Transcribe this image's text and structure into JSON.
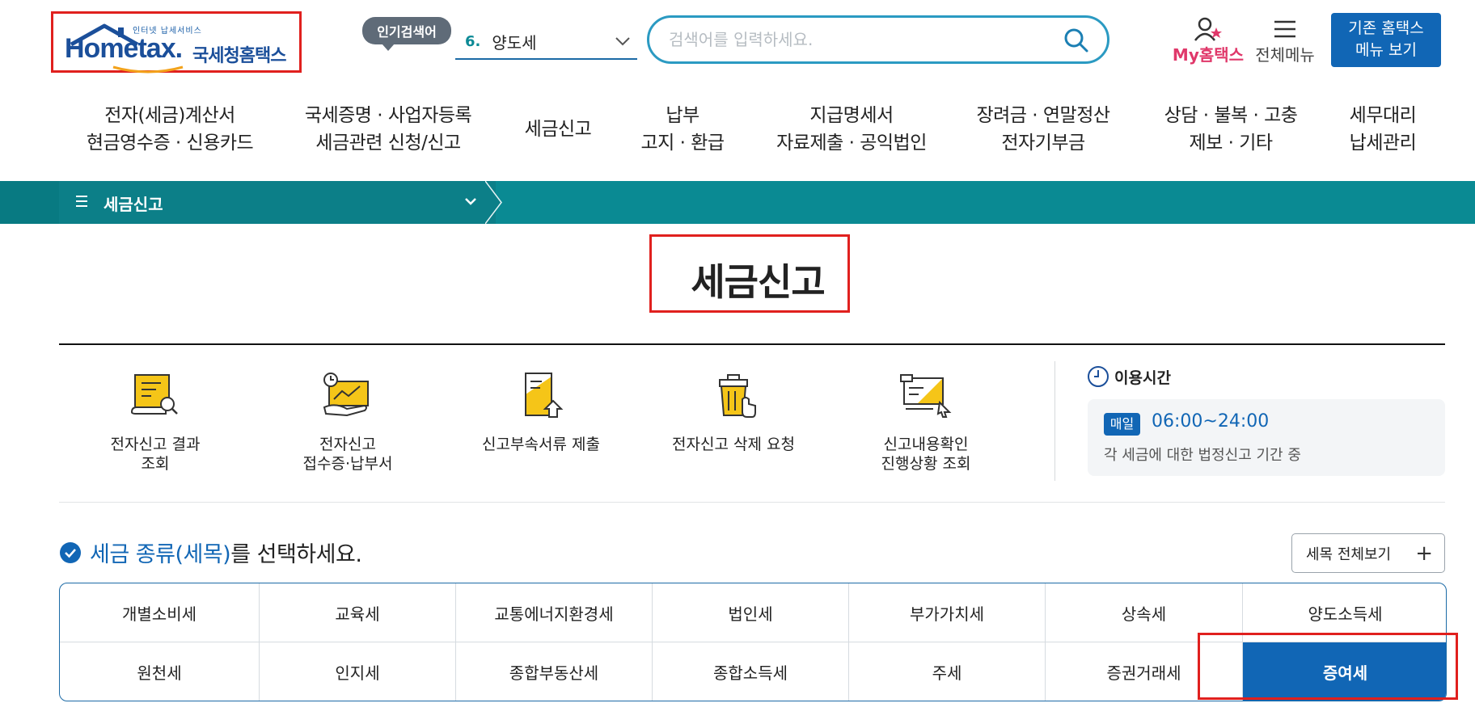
{
  "header": {
    "logo": {
      "small_text": "인터넷 납세서비스",
      "brand": "Hometax.",
      "korean_name": "국세청홈택스"
    },
    "popular": {
      "badge": "인기검색어",
      "rank": "6.",
      "keyword": "양도세"
    },
    "search": {
      "placeholder": "검색어를 입력하세요."
    },
    "my_hometax": "My홈택스",
    "all_menu": "전체메뉴",
    "legacy_button": {
      "line1": "기존 홈택스",
      "line2": "메뉴 보기"
    }
  },
  "gnb": [
    {
      "line1": "전자(세금)계산서",
      "line2": "현금영수증 · 신용카드"
    },
    {
      "line1": "국세증명 · 사업자등록",
      "line2": "세금관련 신청/신고"
    },
    {
      "line1": "세금신고",
      "line2": ""
    },
    {
      "line1": "납부",
      "line2": "고지 · 환급"
    },
    {
      "line1": "지급명세서",
      "line2": "자료제출 · 공익법인"
    },
    {
      "line1": "장려금 · 연말정산",
      "line2": "전자기부금"
    },
    {
      "line1": "상담 · 불복 · 고충",
      "line2": "제보 · 기타"
    },
    {
      "line1": "세무대리",
      "line2": "납세관리"
    }
  ],
  "breadcrumb": {
    "label": "세금신고"
  },
  "page_title": "세금신고",
  "quick_links": [
    {
      "line1": "전자신고 결과",
      "line2": "조회",
      "icon": "document-search-icon"
    },
    {
      "line1": "전자신고",
      "line2": "접수증·납부서",
      "icon": "receipt-clock-icon"
    },
    {
      "line1": "신고부속서류 제출",
      "line2": "",
      "icon": "document-upload-icon"
    },
    {
      "line1": "전자신고 삭제 요청",
      "line2": "",
      "icon": "trash-delete-icon"
    },
    {
      "line1": "신고내용확인",
      "line2": "진행상황 조회",
      "icon": "report-check-icon"
    }
  ],
  "usage": {
    "title": "이용시간",
    "badge": "매일",
    "time": "06:00~24:00",
    "note": "각 세금에 대한 법정신고 기간 중"
  },
  "select_tax": {
    "highlight": "세금 종류(세목)",
    "rest": "를 선택하세요.",
    "all_view_button": "세목 전체보기",
    "rows": [
      [
        "개별소비세",
        "교육세",
        "교통에너지환경세",
        "법인세",
        "부가가치세",
        "상속세",
        "양도소득세"
      ],
      [
        "원천세",
        "인지세",
        "종합부동산세",
        "종합소득세",
        "주세",
        "증권거래세",
        "증여세"
      ]
    ],
    "selected": "증여세"
  },
  "colors": {
    "primary": "#1166b5",
    "teal": "#0a8a93",
    "highlight_red": "#e0201e",
    "my_pink": "#e0386a"
  }
}
